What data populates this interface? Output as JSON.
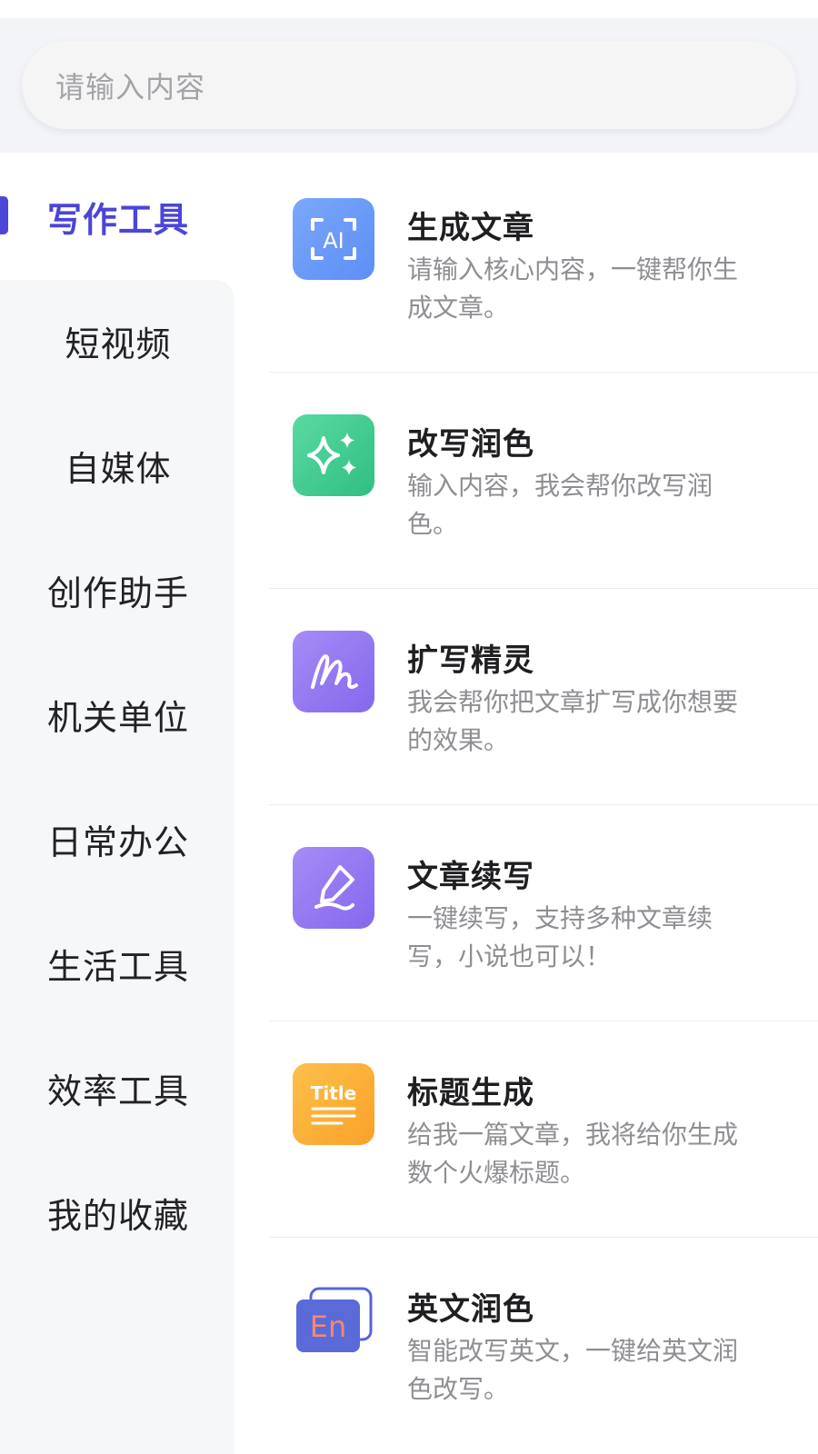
{
  "search": {
    "placeholder": "请输入内容"
  },
  "sidebar": {
    "active_index": 0,
    "items": [
      {
        "label": "写作工具"
      },
      {
        "label": "短视频"
      },
      {
        "label": "自媒体"
      },
      {
        "label": "创作助手"
      },
      {
        "label": "机关单位"
      },
      {
        "label": "日常办公"
      },
      {
        "label": "生活工具"
      },
      {
        "label": "效率工具"
      },
      {
        "label": "我的收藏"
      }
    ]
  },
  "tools": [
    {
      "title": "生成文章",
      "desc": "请输入核心内容，一键帮你生成文章。",
      "icon": "ai-scan-icon",
      "color_from": "#7aa8fb",
      "color_to": "#5d8ef5",
      "icon_text": "AI"
    },
    {
      "title": "改写润色",
      "desc": "输入内容，我会帮你改写润色。",
      "icon": "sparkle-icon",
      "color_from": "#5bd9a2",
      "color_to": "#2fbf82"
    },
    {
      "title": "扩写精灵",
      "desc": "我会帮你把文章扩写成你想要的效果。",
      "icon": "scribble-icon",
      "color_from": "#a58cf6",
      "color_to": "#8567ec"
    },
    {
      "title": "文章续写",
      "desc": "一键续写，支持多种文章续写，小说也可以！",
      "icon": "pen-icon",
      "color_from": "#a58cf6",
      "color_to": "#8567ec"
    },
    {
      "title": "标题生成",
      "desc": "给我一篇文章，我将给你生成数个火爆标题。",
      "icon": "title-doc-icon",
      "color_from": "#fdc04a",
      "color_to": "#f9a12a",
      "icon_text": "Title"
    },
    {
      "title": "英文润色",
      "desc": "智能改写英文，一键给英文润色改写。",
      "icon": "en-badge-icon",
      "color_from": "#5a6ad8",
      "color_to": "#4a55c6",
      "icon_text": "En"
    }
  ]
}
